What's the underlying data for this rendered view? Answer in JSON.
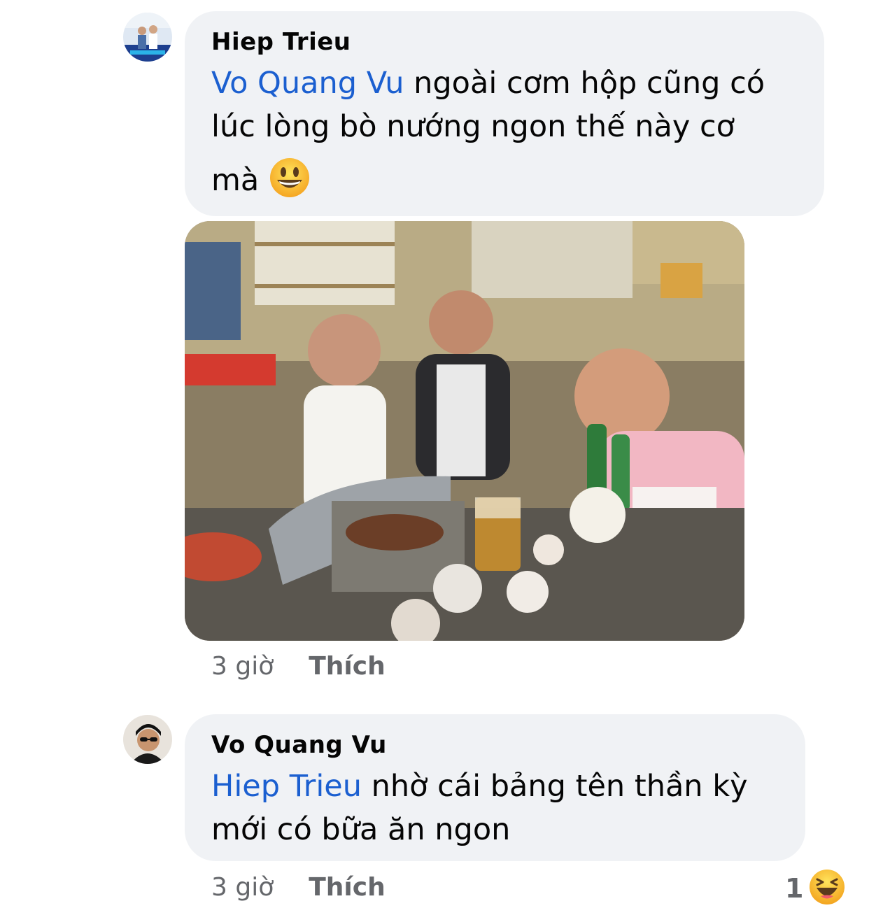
{
  "comments": [
    {
      "author": "Hiep Trieu",
      "mention": "Vo Quang Vu",
      "text_line1": " ngoài cơm hộp cũng có",
      "text_line2": "lúc lòng bò nướng ngon thế này cơ",
      "text_line3": "mà",
      "emoji": "smiley-face",
      "time": "3 giờ",
      "like_label": "Thích"
    },
    {
      "author": "Vo Quang Vu",
      "mention": "Hiep Trieu",
      "text_line1": " nhờ cái bảng tên thần kỳ",
      "text_line2": "mới có bữa ăn ngon",
      "time": "3 giờ",
      "like_label": "Thích",
      "reaction_count": "1",
      "reaction_icon": "laughing-face"
    }
  ],
  "colors": {
    "mention": "#1b5fd0",
    "bubble": "#f0f2f5",
    "meta": "#65676b"
  }
}
